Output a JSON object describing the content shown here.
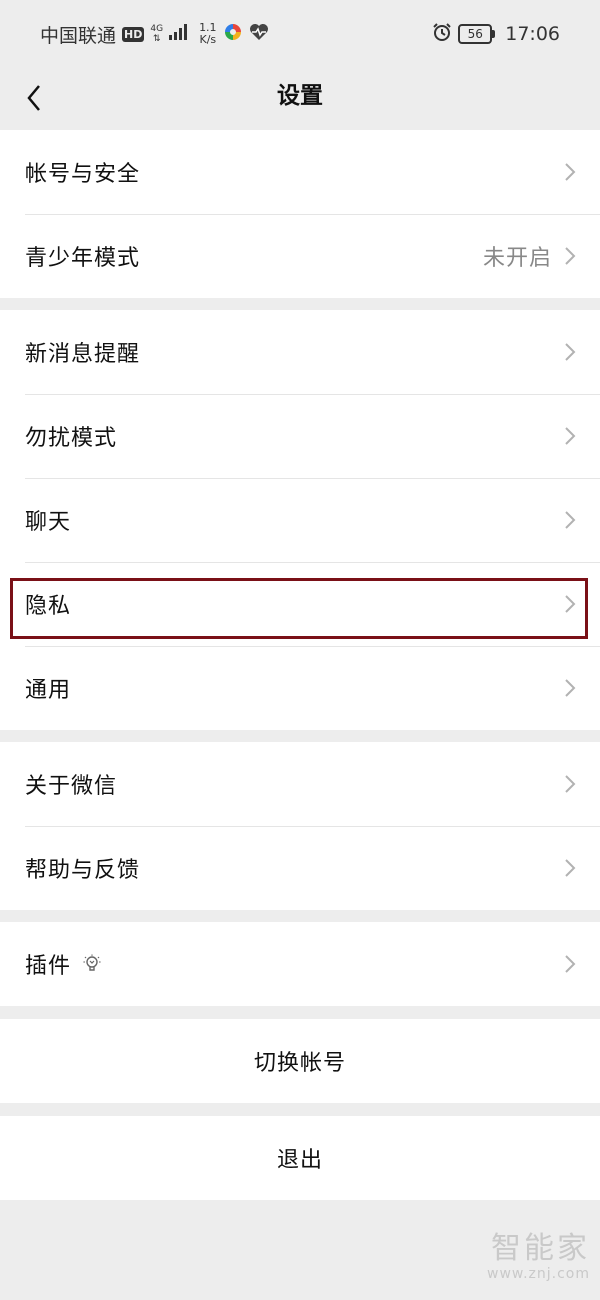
{
  "status_bar": {
    "carrier": "中国联通",
    "hd": "HD",
    "network": "4G",
    "speed_value": "1.1",
    "speed_unit": "K/s",
    "battery": "56",
    "time": "17:06"
  },
  "nav": {
    "title": "设置"
  },
  "groups": {
    "account": {
      "items": [
        {
          "label": "帐号与安全",
          "value": ""
        },
        {
          "label": "青少年模式",
          "value": "未开启"
        }
      ]
    },
    "settings": {
      "items": [
        {
          "label": "新消息提醒"
        },
        {
          "label": "勿扰模式"
        },
        {
          "label": "聊天"
        },
        {
          "label": "隐私"
        },
        {
          "label": "通用"
        }
      ]
    },
    "about": {
      "items": [
        {
          "label": "关于微信"
        },
        {
          "label": "帮助与反馈"
        }
      ]
    },
    "plugins": {
      "items": [
        {
          "label": "插件"
        }
      ]
    }
  },
  "actions": {
    "switch_account": "切换帐号",
    "logout": "退出"
  },
  "watermark": {
    "text": "智能家",
    "url": "www.znj.com"
  },
  "colors": {
    "background": "#ededed",
    "highlight_border": "#7a1017",
    "secondary_text": "#888888"
  }
}
